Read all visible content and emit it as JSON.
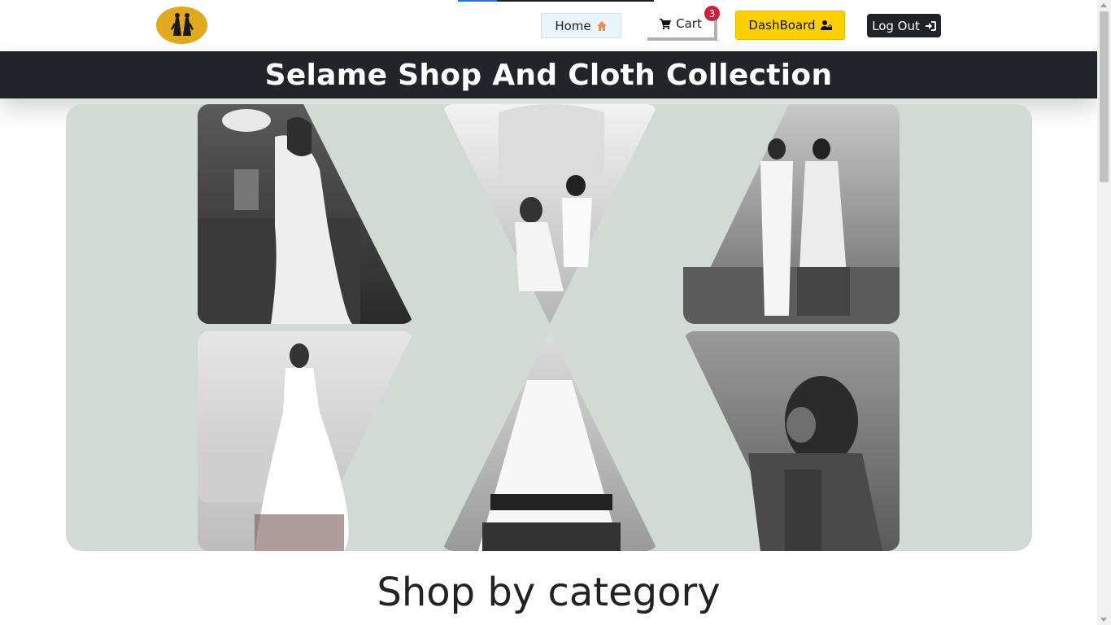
{
  "nav": {
    "home_label": "Home",
    "cart_label": "Cart",
    "cart_count": "3",
    "dashboard_label": "DashBoard",
    "logout_label": "Log Out"
  },
  "banner": {
    "title": "Selame Shop And Cloth Collection"
  },
  "hero": {
    "images": [
      "dress-photo",
      "couple-photo",
      "couple-outdoor-photo",
      "white-dress-photo",
      "dress-pattern-photo",
      "traditional-outfit-photo"
    ]
  },
  "sections": {
    "category_title": "Shop by category"
  },
  "colors": {
    "accent_yellow": "#ffd000",
    "banner_dark": "#212529",
    "hero_background": "#d1dad5",
    "badge_red": "#c8213f",
    "logo_gold": "#e0a91f"
  }
}
